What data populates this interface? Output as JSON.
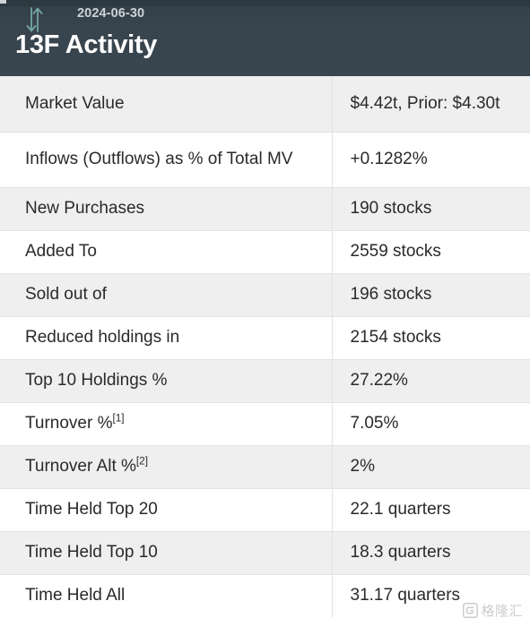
{
  "header": {
    "date": "2024-06-30",
    "title": "13F Activity",
    "icon": "up-down-arrow-icon",
    "background_color": "#38444e",
    "title_color": "#ffffff",
    "date_color": "#ccd2d7",
    "icon_color": "#74a6a0"
  },
  "table": {
    "rows": [
      {
        "label": "Market Value",
        "value": "$4.42t, Prior: $4.30t",
        "tall": true,
        "striped": true,
        "color": "default",
        "footnote": ""
      },
      {
        "label": "Inflows (Outflows) as % of Total MV",
        "value": "+0.1282%",
        "tall": true,
        "striped": false,
        "color": "green",
        "footnote": ""
      },
      {
        "label": "New Purchases",
        "value": "190 stocks",
        "tall": false,
        "striped": true,
        "color": "default",
        "footnote": ""
      },
      {
        "label": "Added To",
        "value": "2559 stocks",
        "tall": false,
        "striped": false,
        "color": "default",
        "footnote": ""
      },
      {
        "label": "Sold out of",
        "value": "196 stocks",
        "tall": false,
        "striped": true,
        "color": "default",
        "footnote": ""
      },
      {
        "label": "Reduced holdings in",
        "value": "2154 stocks",
        "tall": false,
        "striped": false,
        "color": "default",
        "footnote": ""
      },
      {
        "label": "Top 10 Holdings %",
        "value": "27.22%",
        "tall": false,
        "striped": true,
        "color": "default",
        "footnote": ""
      },
      {
        "label": "Turnover %",
        "value": "7.05%",
        "tall": false,
        "striped": false,
        "color": "default",
        "footnote": "[1]"
      },
      {
        "label": "Turnover Alt %",
        "value": "2%",
        "tall": false,
        "striped": true,
        "color": "default",
        "footnote": "[2]"
      },
      {
        "label": "Time Held Top 20",
        "value": "22.1 quarters",
        "tall": false,
        "striped": false,
        "color": "default",
        "footnote": ""
      },
      {
        "label": "Time Held Top 10",
        "value": "18.3 quarters",
        "tall": false,
        "striped": true,
        "color": "default",
        "footnote": ""
      },
      {
        "label": "Time Held All",
        "value": "31.17 quarters",
        "tall": false,
        "striped": false,
        "color": "default",
        "footnote": ""
      }
    ],
    "green_color": "#1a8b1c",
    "stripe_color": "#efefef",
    "border_color": "#e2e2e2"
  },
  "watermark": {
    "text": "格隆汇",
    "logo": "gelonghui-logo-icon"
  }
}
